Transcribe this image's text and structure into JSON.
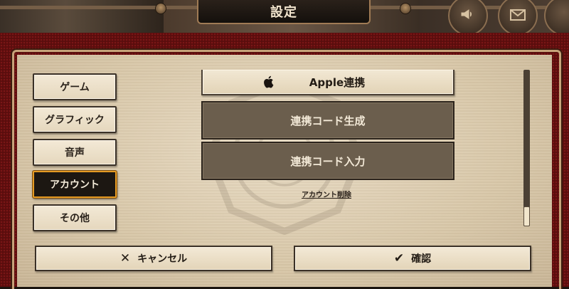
{
  "title": "設定",
  "header_icons": [
    "megaphone-icon",
    "mail-icon"
  ],
  "tabs": [
    {
      "label": "ゲーム",
      "active": false
    },
    {
      "label": "グラフィック",
      "active": false
    },
    {
      "label": "音声",
      "active": false
    },
    {
      "label": "アカウント",
      "active": true
    },
    {
      "label": "その他",
      "active": false
    }
  ],
  "account": {
    "apple_link_label": "Apple連携",
    "generate_code_label": "連携コード生成",
    "enter_code_label": "連携コード入力",
    "delete_account_label": "アカウント削除"
  },
  "footer": {
    "cancel_label": "キャンセル",
    "confirm_label": "確認"
  },
  "colors": {
    "active_tab_border": "#e59b25",
    "frame_red": "#5a0d0d",
    "panel_beige": "#d8c7a8",
    "dark_button": "#6b5e4d"
  }
}
